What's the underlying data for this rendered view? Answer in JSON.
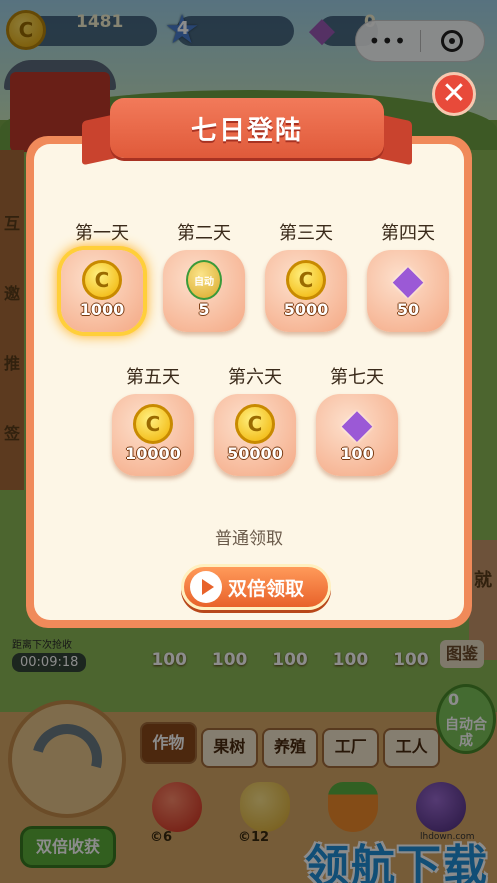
{
  "hud": {
    "coins": "1481",
    "level": "4",
    "gems": "0"
  },
  "left_side_labels": [
    "互",
    "邀",
    "推",
    "签"
  ],
  "right_side_label": "就",
  "timer": {
    "label": "距离下次抢收",
    "value": "00:09:18"
  },
  "plots": [
    "100",
    "100",
    "100",
    "100",
    "100"
  ],
  "tujian": "图鉴",
  "auto_button": {
    "count": "0",
    "label": "自动合成"
  },
  "tabs": [
    "作物",
    "果树",
    "养殖",
    "工厂",
    "工人"
  ],
  "active_tab": "作物",
  "crops": [
    {
      "name": "tomato",
      "price": "6"
    },
    {
      "name": "wheat",
      "price": "12"
    },
    {
      "name": "carrot",
      "price": ""
    },
    {
      "name": "grape",
      "price": ""
    }
  ],
  "harvest_button": "双倍收获",
  "watermark": {
    "text": "领航下载",
    "url": "lhdown.com"
  },
  "dialog": {
    "title": "七日登陆",
    "days": [
      {
        "label": "第一天",
        "reward": "coin",
        "amount": "1000",
        "claimed": true
      },
      {
        "label": "第二天",
        "reward": "auto",
        "amount": "5",
        "badge": "自动"
      },
      {
        "label": "第三天",
        "reward": "coin",
        "amount": "5000"
      },
      {
        "label": "第四天",
        "reward": "gem",
        "amount": "50"
      },
      {
        "label": "第五天",
        "reward": "coin",
        "amount": "10000"
      },
      {
        "label": "第六天",
        "reward": "coin",
        "amount": "50000"
      },
      {
        "label": "第七天",
        "reward": "gem",
        "amount": "100"
      }
    ],
    "normal_claim": "普通领取",
    "double_claim": "双倍领取",
    "close": "✕"
  },
  "colors": {
    "dialog_border": "#f08a5a",
    "ribbon": "#e05a3a",
    "claimed_glow": "#ffcf3a"
  }
}
